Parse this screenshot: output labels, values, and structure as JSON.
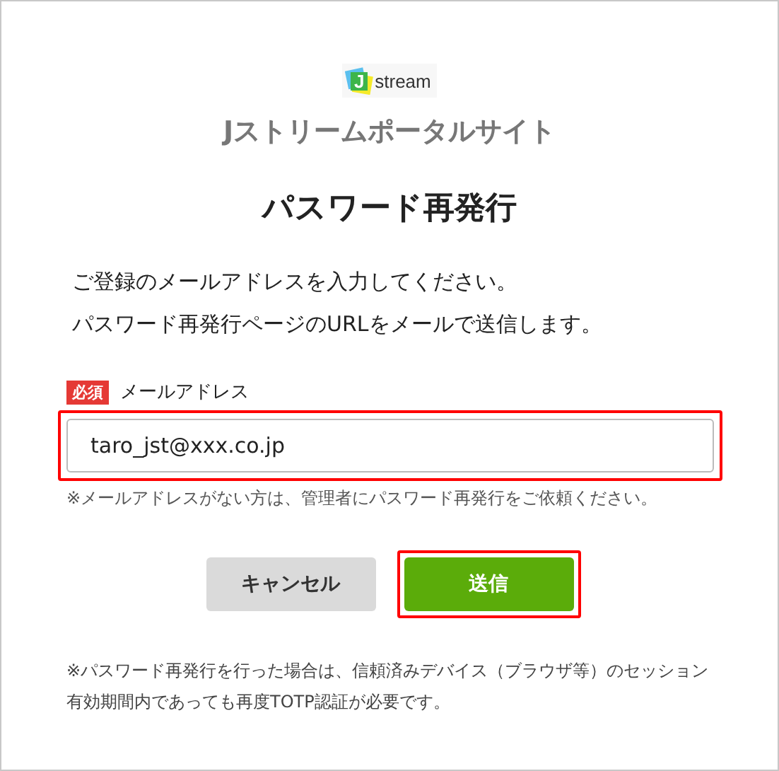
{
  "logo": {
    "mark": "J",
    "text": "stream"
  },
  "site_title": "Jストリームポータルサイト",
  "heading": "パスワード再発行",
  "description": [
    "ご登録のメールアドレスを入力してください。",
    "パスワード再発行ページのURLをメールで送信します。"
  ],
  "email_field": {
    "required_badge": "必須",
    "label": "メールアドレス",
    "value": "taro_jst@xxx.co.jp",
    "highlighted": true
  },
  "field_note": "※メールアドレスがない方は、管理者にパスワード再発行をご依頼ください。",
  "buttons": [
    {
      "kind": "secondary",
      "label": "キャンセル",
      "highlighted": false
    },
    {
      "kind": "primary",
      "label": "送信",
      "highlighted": true
    }
  ],
  "footer_note": "※パスワード再発行を行った場合は、信頼済みデバイス（ブラウザ等）のセッション有効期間内であっても再度TOTP認証が必要です。"
}
